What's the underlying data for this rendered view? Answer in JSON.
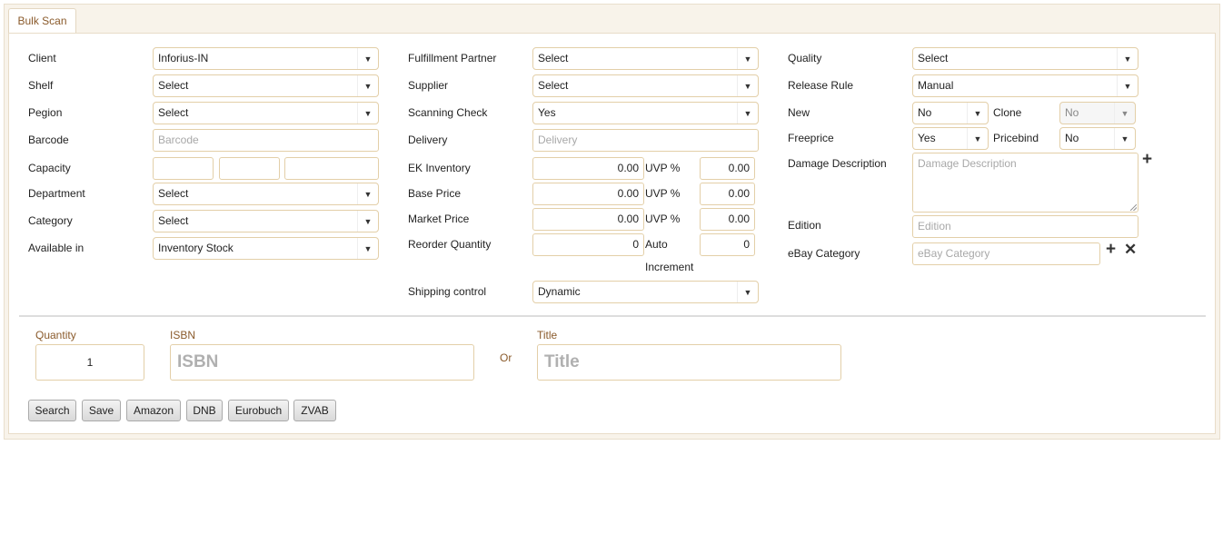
{
  "tab": {
    "label": "Bulk Scan"
  },
  "col1": {
    "client": {
      "label": "Client",
      "value": "Inforius-IN"
    },
    "shelf": {
      "label": "Shelf",
      "value": "Select"
    },
    "region": {
      "label": "Pegion",
      "value": "Select"
    },
    "barcode": {
      "label": "Barcode",
      "placeholder": "Barcode"
    },
    "capacity": {
      "label": "Capacity",
      "values": [
        "",
        "",
        ""
      ]
    },
    "department": {
      "label": "Department",
      "value": "Select"
    },
    "category": {
      "label": "Category",
      "value": "Select"
    },
    "available_in": {
      "label": "Available in",
      "value": "Inventory Stock"
    }
  },
  "col2": {
    "fulfillment_partner": {
      "label": "Fulfillment Partner",
      "value": "Select"
    },
    "supplier": {
      "label": "Supplier",
      "value": "Select"
    },
    "scanning_check": {
      "label": "Scanning Check",
      "value": "Yes"
    },
    "delivery": {
      "label": "Delivery",
      "placeholder": "Delivery"
    },
    "ek_inventory": {
      "label": "EK Inventory",
      "value": "0.00",
      "uvp_label": "UVP %",
      "uvp_value": "0.00"
    },
    "base_price": {
      "label": "Base Price",
      "value": "0.00",
      "uvp_label": "UVP %",
      "uvp_value": "0.00"
    },
    "market_price": {
      "label": "Market Price",
      "value": "0.00",
      "uvp_label": "UVP %",
      "uvp_value": "0.00"
    },
    "reorder_quantity": {
      "label": "Reorder Quantity",
      "value": "0",
      "auto_label": "Auto",
      "increment_label": "Increment",
      "auto_value": "0"
    },
    "shipping_control": {
      "label": "Shipping control",
      "value": "Dynamic"
    }
  },
  "col3": {
    "quality": {
      "label": "Quality",
      "value": "Select"
    },
    "release_rule": {
      "label": "Release Rule",
      "value": "Manual"
    },
    "new": {
      "label": "New",
      "value": "No"
    },
    "clone": {
      "label": "Clone",
      "value": "No"
    },
    "freeprice": {
      "label": "Freeprice",
      "value": "Yes"
    },
    "pricebind": {
      "label": "Pricebind",
      "value": "No"
    },
    "damage_description": {
      "label": "Damage Description",
      "placeholder": "Damage Description"
    },
    "edition": {
      "label": "Edition",
      "placeholder": "Edition"
    },
    "ebay_category": {
      "label": "eBay Category",
      "placeholder": "eBay Category"
    }
  },
  "bottom": {
    "quantity": {
      "label": "Quantity",
      "value": "1"
    },
    "isbn": {
      "label": "ISBN",
      "placeholder": "ISBN"
    },
    "or_label": "Or",
    "title": {
      "label": "Title",
      "placeholder": "Title"
    }
  },
  "buttons": {
    "search": "Search",
    "save": "Save",
    "amazon": "Amazon",
    "dnb": "DNB",
    "eurobuch": "Eurobuch",
    "zvab": "ZVAB"
  },
  "icons": {
    "plus": "+",
    "close": "✕",
    "dropdown": "▼"
  }
}
